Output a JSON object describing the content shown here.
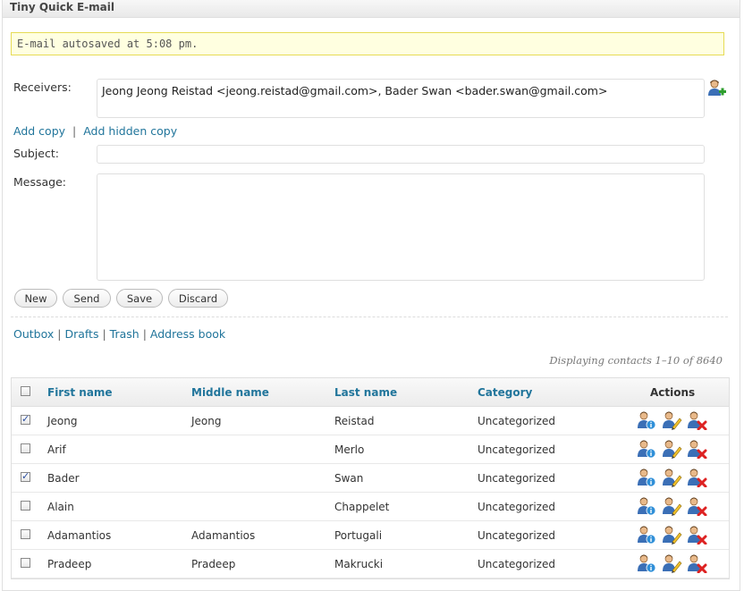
{
  "app": {
    "title": "Tiny Quick E-mail"
  },
  "notice": "E-mail autosaved at 5:08 pm.",
  "form": {
    "receivers_label": "Receivers:",
    "receivers_value": "Jeong Jeong Reistad <jeong.reistad@gmail.com>, Bader Swan <bader.swan@gmail.com>",
    "add_copy": "Add copy",
    "separator": "|",
    "add_hidden_copy": "Add hidden copy",
    "subject_label": "Subject:",
    "subject_value": "",
    "message_label": "Message:",
    "message_value": ""
  },
  "buttons": {
    "new": "New",
    "send": "Send",
    "save": "Save",
    "discard": "Discard"
  },
  "nav": {
    "outbox": "Outbox",
    "drafts": "Drafts",
    "trash": "Trash",
    "address_book": "Address book",
    "sep": "|"
  },
  "displaying": "Displaying contacts 1–10 of 8640",
  "table": {
    "headers": {
      "first": "First name",
      "middle": "Middle name",
      "last": "Last name",
      "category": "Category",
      "actions": "Actions"
    },
    "rows": [
      {
        "checked": true,
        "first": "Jeong",
        "middle": "Jeong",
        "last": "Reistad",
        "category": "Uncategorized"
      },
      {
        "checked": false,
        "first": "Arif",
        "middle": "",
        "last": "Merlo",
        "category": "Uncategorized"
      },
      {
        "checked": true,
        "first": "Bader",
        "middle": "",
        "last": "Swan",
        "category": "Uncategorized"
      },
      {
        "checked": false,
        "first": "Alain",
        "middle": "",
        "last": "Chappelet",
        "category": "Uncategorized"
      },
      {
        "checked": false,
        "first": "Adamantios",
        "middle": "Adamantios",
        "last": "Portugali",
        "category": "Uncategorized"
      },
      {
        "checked": false,
        "first": "Pradeep",
        "middle": "Pradeep",
        "last": "Makrucki",
        "category": "Uncategorized"
      }
    ],
    "action_icons": [
      "contact-info-icon",
      "edit-contact-icon",
      "delete-contact-icon"
    ]
  },
  "colors": {
    "link": "#21759b",
    "notice_bg": "#ffffe0",
    "notice_border": "#e6db55"
  }
}
